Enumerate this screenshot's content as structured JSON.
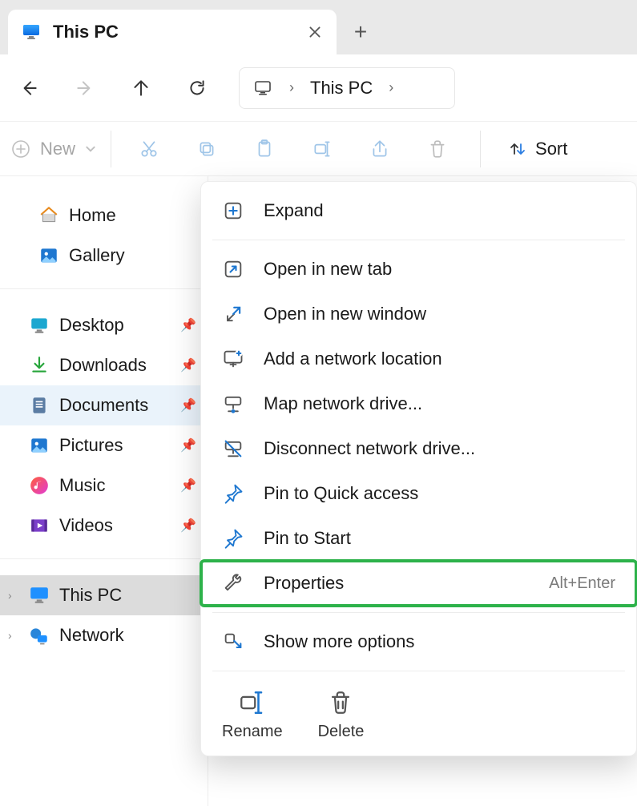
{
  "tab": {
    "title": "This PC"
  },
  "address": {
    "label": "This PC"
  },
  "toolbar": {
    "new": "New",
    "sort": "Sort"
  },
  "sidebar": {
    "home": "Home",
    "gallery": "Gallery",
    "desktop": "Desktop",
    "downloads": "Downloads",
    "documents": "Documents",
    "pictures": "Pictures",
    "music": "Music",
    "videos": "Videos",
    "thispc": "This PC",
    "network": "Network"
  },
  "ctx": {
    "expand": "Expand",
    "open_tab": "Open in new tab",
    "open_win": "Open in new window",
    "add_net": "Add a network location",
    "map_drive": "Map network drive...",
    "disc_drive": "Disconnect network drive...",
    "pin_quick": "Pin to Quick access",
    "pin_start": "Pin to Start",
    "properties": "Properties",
    "properties_sc": "Alt+Enter",
    "show_more": "Show more options",
    "rename": "Rename",
    "delete": "Delete"
  },
  "highlight": "properties"
}
